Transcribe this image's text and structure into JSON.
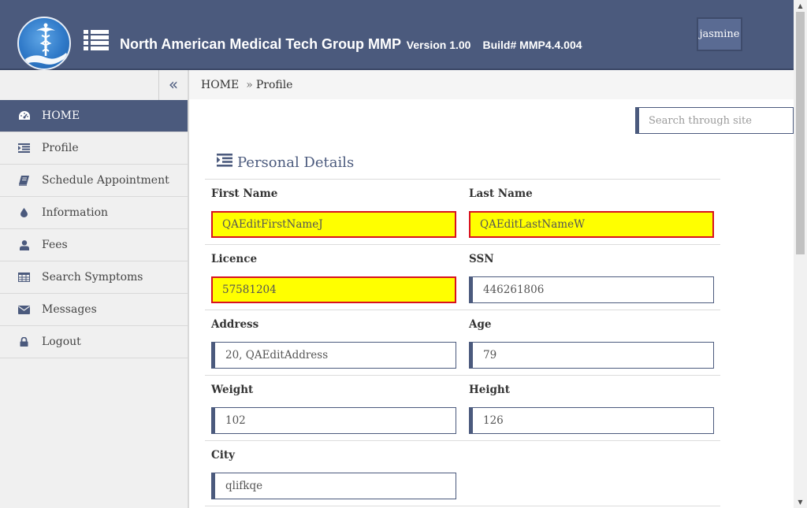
{
  "header": {
    "title": "North American Medical Tech Group MMP",
    "version": "Version 1.00",
    "build": "Build# MMP4.4.004",
    "user": "jasmine"
  },
  "sidebar": {
    "collapse_glyph": "«",
    "items": [
      {
        "label": "HOME",
        "icon": "dashboard-icon",
        "active": true
      },
      {
        "label": "Profile",
        "icon": "profile-list-icon"
      },
      {
        "label": "Schedule Appointment",
        "icon": "book-icon"
      },
      {
        "label": "Information",
        "icon": "drop-icon"
      },
      {
        "label": "Fees",
        "icon": "user-icon"
      },
      {
        "label": "Search Symptoms",
        "icon": "table-icon"
      },
      {
        "label": "Messages",
        "icon": "envelope-icon"
      },
      {
        "label": "Logout",
        "icon": "lock-icon"
      }
    ]
  },
  "breadcrumb": {
    "home": "HOME",
    "separator": "»",
    "current": "Profile"
  },
  "search": {
    "placeholder": "Search through site"
  },
  "personal_details": {
    "title": "Personal Details",
    "fields": {
      "first_name": {
        "label": "First Name",
        "value": "QAEditFirstNameJ"
      },
      "last_name": {
        "label": "Last Name",
        "value": "QAEditLastNameW"
      },
      "licence": {
        "label": "Licence",
        "value": "57581204"
      },
      "ssn": {
        "label": "SSN",
        "value": "446261806"
      },
      "address": {
        "label": "Address",
        "value": "20, QAEditAddress"
      },
      "age": {
        "label": "Age",
        "value": "79"
      },
      "weight": {
        "label": "Weight",
        "value": "102"
      },
      "height": {
        "label": "Height",
        "value": "126"
      },
      "city": {
        "label": "City",
        "value": "qlifkqe"
      }
    }
  },
  "colors": {
    "header_bg": "#4b5a7d",
    "error_fill": "#ffff00",
    "error_border": "#d9121f"
  }
}
